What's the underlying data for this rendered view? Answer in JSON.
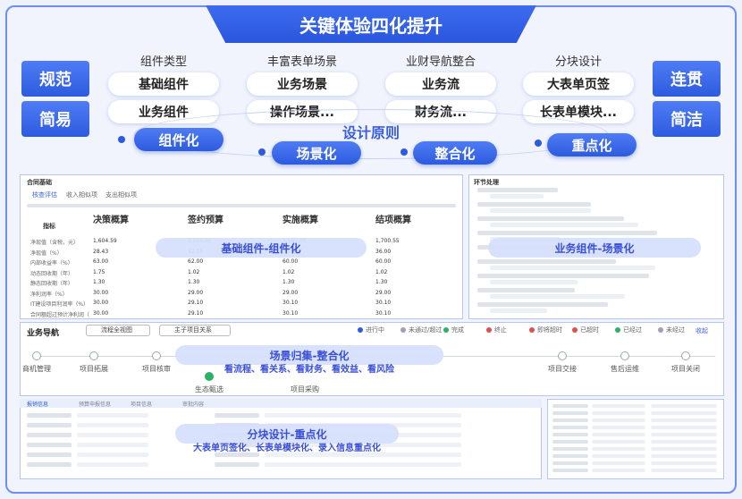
{
  "title": "关键体验四化提升",
  "left_labels": [
    "规范",
    "简易"
  ],
  "right_labels": [
    "连贯",
    "简洁"
  ],
  "categories": [
    {
      "label": "组件类型",
      "items": [
        "基础组件",
        "业务组件"
      ]
    },
    {
      "label": "丰富表单场景",
      "items": [
        "业务场景",
        "操作场景..."
      ]
    },
    {
      "label": "业财导航整合",
      "items": [
        "业务流",
        "财务流..."
      ]
    },
    {
      "label": "分块设计",
      "items": [
        "大表单页签",
        "长表单模块..."
      ]
    }
  ],
  "principles": [
    "组件化",
    "场景化",
    "整合化",
    "重点化"
  ],
  "principle_center": "设计原则",
  "panels": {
    "basic": {
      "overlay": "基础组件-组件化",
      "header": "合同基础",
      "tabs": [
        "核查评估",
        "收入相似项",
        "支出相似项"
      ],
      "table_title": "指标",
      "columns": [
        "决策概算",
        "签约预算",
        "实施概算",
        "结项概算"
      ],
      "row_labels": [
        "净现值（含税，元）",
        "净现值（%）",
        "内部收益率（%）",
        "动态回收期（年）",
        "静态回收期（年）",
        "净利润率（%）",
        "IT建设项目利润率（%）",
        "合同额超过预计净利润（%）"
      ],
      "cells": [
        [
          "1,604.59",
          "1,500.00",
          "1,502.00",
          "1,700.55"
        ],
        [
          "28.43",
          "32.15",
          "35.00",
          "36.00"
        ],
        [
          "63.00",
          "62.00",
          "60.00",
          "60.00"
        ],
        [
          "1.75",
          "1.02",
          "1.02",
          "1.02"
        ],
        [
          "1.30",
          "1.30",
          "1.30",
          "1.30"
        ],
        [
          "30.00",
          "29.00",
          "29.00",
          "29.00"
        ],
        [
          "30.00",
          "29.10",
          "30.10",
          "30.10"
        ],
        [
          "30.00",
          "29.10",
          "30.10",
          "30.10"
        ]
      ]
    },
    "business": {
      "overlay": "业务组件-场景化",
      "header": "环节处理"
    },
    "scene": {
      "overlay": "场景归集-整合化",
      "subtitle": "看流程、看关系、看财务、看效益、看风险",
      "nav_title": "业务导航",
      "nav_buttons": [
        "流程全视图",
        "主子项目关系"
      ],
      "legend": [
        "进行中",
        "未通过/超过",
        "完成",
        "终止",
        "即将超时",
        "已超时",
        "已经过",
        "未经过"
      ],
      "collapse": "收起",
      "flow_nodes": [
        "商机管理",
        "项目拓展",
        "项目核审",
        "项目交接",
        "售后运维",
        "项目关闭"
      ],
      "branch_nodes": [
        "生态甄选",
        "项目采购"
      ]
    },
    "block": {
      "overlay": "分块设计-重点化",
      "subtitle": "大表单页签化、长表单模块化、录入信息重点化",
      "tabs": [
        "报销信息",
        "预算申报信息",
        "项目信息",
        "审批内容"
      ]
    }
  }
}
